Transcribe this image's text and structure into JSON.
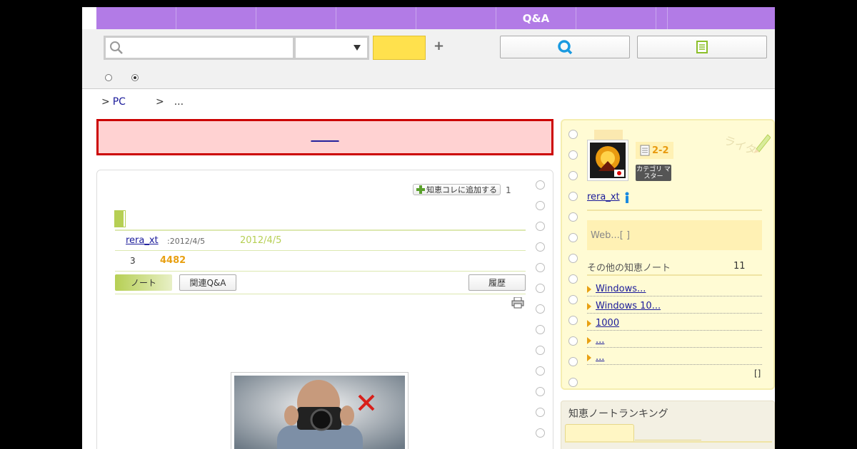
{
  "nav": {
    "items": [
      "",
      "",
      "",
      "",
      "",
      "Q&A",
      "",
      "",
      ""
    ]
  },
  "search": {
    "input_value": "",
    "select_value": "",
    "go_label": "",
    "plus": "+"
  },
  "breadcrumb": {
    "sep1": ">",
    "link": "PC",
    "sep2": ">",
    "tail": "..."
  },
  "alert": {
    "link": "______"
  },
  "note": {
    "collect_label": "知恵コレに追加する",
    "collect_count": "1",
    "author": "rera_xt",
    "created": ":2012/4/5",
    "updated": "2012/4/5",
    "stat_a": "3",
    "views": "4482",
    "tab_note": "ノート",
    "tab_qa": "関連Q&A",
    "tab_history": "履歴"
  },
  "sidebar": {
    "level": "2-2",
    "category_badge": "カテゴリ マスター",
    "author": "rera_xt",
    "web_box": "Web...[         ]",
    "others_title": "その他の知恵ノート",
    "others_count": "11",
    "links": [
      "Windows...",
      "Windows 10...",
      "1000",
      "...",
      "..."
    ],
    "more": "[]"
  },
  "ranking": {
    "title": "知恵ノートランキング"
  },
  "colors": {
    "nav_purple": "#b27be6",
    "accent_yellow": "#ffe14d",
    "note_green": "#b6cf54",
    "alert_red": "#cc0000",
    "views_orange": "#e8a013"
  }
}
